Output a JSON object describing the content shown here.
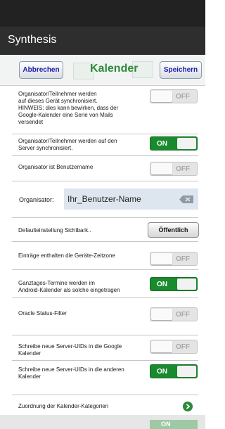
{
  "app": {
    "title": "Synthesis"
  },
  "toolbar": {
    "cancel_label": "Abbrechen",
    "title": "Kalender",
    "save_label": "Speichern"
  },
  "settings": {
    "organizer_sync_device": {
      "label": "Organisator/Teilnehmer werden\nauf dieses Gerät synchronisiert.\nHINWEIS: dies kann bewirken, dass der\nGoogle-Kalender eine Serie von Mails\nversendet",
      "state": "OFF"
    },
    "organizer_sync_server": {
      "label": "Organisator/Teilnehmer werden auf den\nServer synchronisiert.",
      "state": "ON"
    },
    "organizer_is_username": {
      "label": "Organisator ist Benutzername",
      "state": "OFF"
    },
    "organizer": {
      "label": "Organisator:",
      "value": "Ihr_Benutzer-Name"
    },
    "default_visibility": {
      "label": "Defaulteinstellung Sichtbark..",
      "value": "Öffentlich"
    },
    "device_timezone": {
      "label": "Einträge enthalten die Geräte-Zeitzone",
      "state": "OFF"
    },
    "allday_events": {
      "label": "Ganztages-Termine werden im\nAndroid-Kalender als solche eingetragen",
      "state": "ON"
    },
    "oracle_status_filter": {
      "label": "Oracle Status-Filter",
      "state": "OFF"
    },
    "server_uids_google": {
      "label": "Schreibe neue Server-UIDs in die Google\nKalender",
      "state": "OFF"
    },
    "server_uids_other": {
      "label": "Schreibe neue Server-UIDs in die anderen\nKalender",
      "state": "ON"
    },
    "category_mapping": {
      "label": "Zuordnung der Kalender-Kategorien"
    },
    "partial_toggle": {
      "state": "ON"
    }
  },
  "colors": {
    "accent_green": "#1a8a2e",
    "title_green": "#2e8b3d",
    "button_blue": "#1b1ea8",
    "app_bar": "#2e2e2e"
  },
  "icons": {
    "clear": "backspace-clear-icon",
    "chevron": "chevron-right-circle-icon"
  }
}
